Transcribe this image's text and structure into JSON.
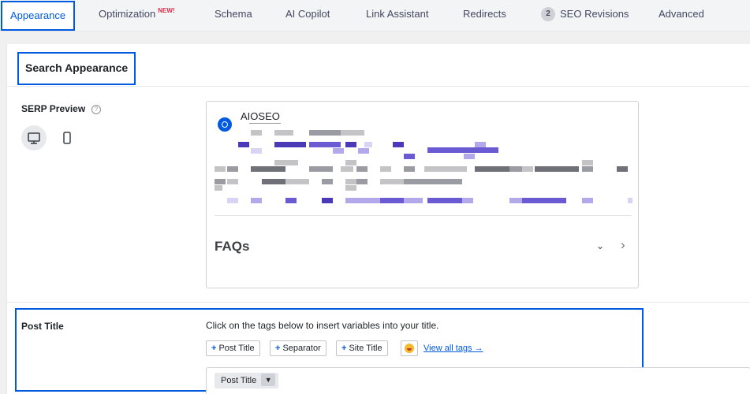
{
  "tabs": [
    {
      "label": "Appearance",
      "active": true
    },
    {
      "label": "Optimization",
      "badge": "NEW!"
    },
    {
      "label": "Schema"
    },
    {
      "label": "AI Copilot"
    },
    {
      "label": "Link Assistant"
    },
    {
      "label": "Redirects"
    },
    {
      "label": "SEO Revisions",
      "count": "2"
    },
    {
      "label": "Advanced"
    }
  ],
  "section": {
    "title": "Search Appearance"
  },
  "serp": {
    "label": "SERP Preview",
    "help": "?",
    "site_name": "AIOSEO",
    "faq_heading": "FAQs"
  },
  "post_title": {
    "label": "Post Title",
    "instructions": "Click on the tags below to insert variables into your title.",
    "tags": [
      "Post Title",
      "Separator",
      "Site Title"
    ],
    "view_all": "View all tags →",
    "editor_tag": "Post Title"
  },
  "colors": {
    "accent": "#005ae0",
    "badge": "#df2a4a"
  }
}
